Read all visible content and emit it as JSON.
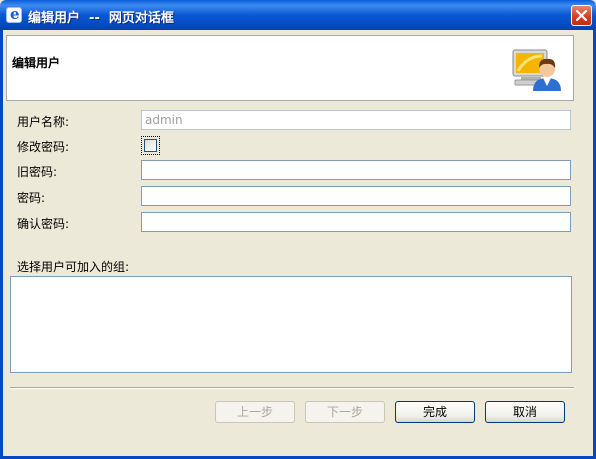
{
  "window": {
    "title": "编辑用户  --  网页对话框",
    "close_icon": "close-icon",
    "app_icon": "ie-icon"
  },
  "header": {
    "heading": "编辑用户",
    "icon": "user-at-computer-icon"
  },
  "form": {
    "username_label": "用户名称:",
    "username_value": "admin",
    "change_password_label": "修改密码:",
    "change_password_checked": false,
    "old_password_label": "旧密码:",
    "old_password_value": "",
    "password_label": "密码:",
    "password_value": "",
    "confirm_password_label": "确认密码:",
    "confirm_password_value": ""
  },
  "groups": {
    "label": "选择用户可加入的组:",
    "items": []
  },
  "buttons": {
    "prev": "上一步",
    "next": "下一步",
    "finish": "完成",
    "cancel": "取消"
  },
  "colors": {
    "titlebar": "#0b58d2",
    "dialog_bg": "#ece9d8",
    "input_border": "#7f9db9"
  }
}
